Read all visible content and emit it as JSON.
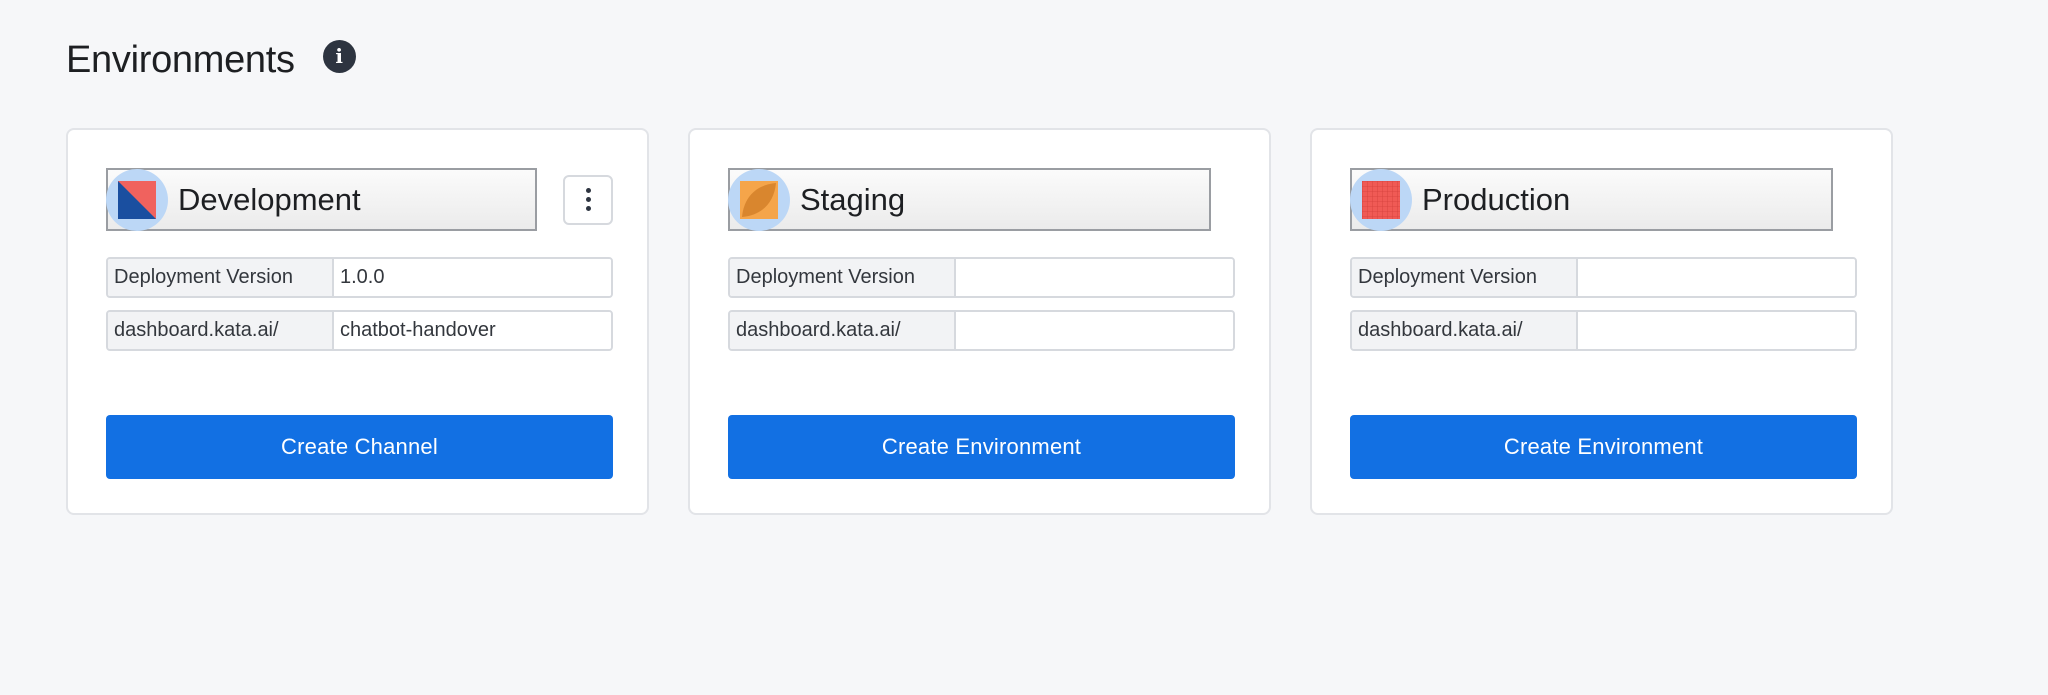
{
  "header": {
    "title": "Environments",
    "info_icon": "i"
  },
  "environments": [
    {
      "name": "Development",
      "avatar_icon": "development-logo-icon",
      "has_menu": true,
      "deployment_label": "Deployment Version",
      "deployment_value": "1.0.0",
      "url_prefix": "dashboard.kata.ai/",
      "url_value": "chatbot-handover",
      "button_label": "Create Channel"
    },
    {
      "name": "Staging",
      "avatar_icon": "staging-logo-icon",
      "has_menu": false,
      "deployment_label": "Deployment Version",
      "deployment_value": "",
      "url_prefix": "dashboard.kata.ai/",
      "url_value": "",
      "button_label": "Create Environment"
    },
    {
      "name": "Production",
      "avatar_icon": "production-logo-icon",
      "has_menu": false,
      "deployment_label": "Deployment Version",
      "deployment_value": "",
      "url_prefix": "dashboard.kata.ai/",
      "url_value": "",
      "button_label": "Create Environment"
    }
  ],
  "colors": {
    "primary": "#1270e3",
    "background": "#f6f7f9",
    "avatar_bg": "#bcd7f6"
  }
}
